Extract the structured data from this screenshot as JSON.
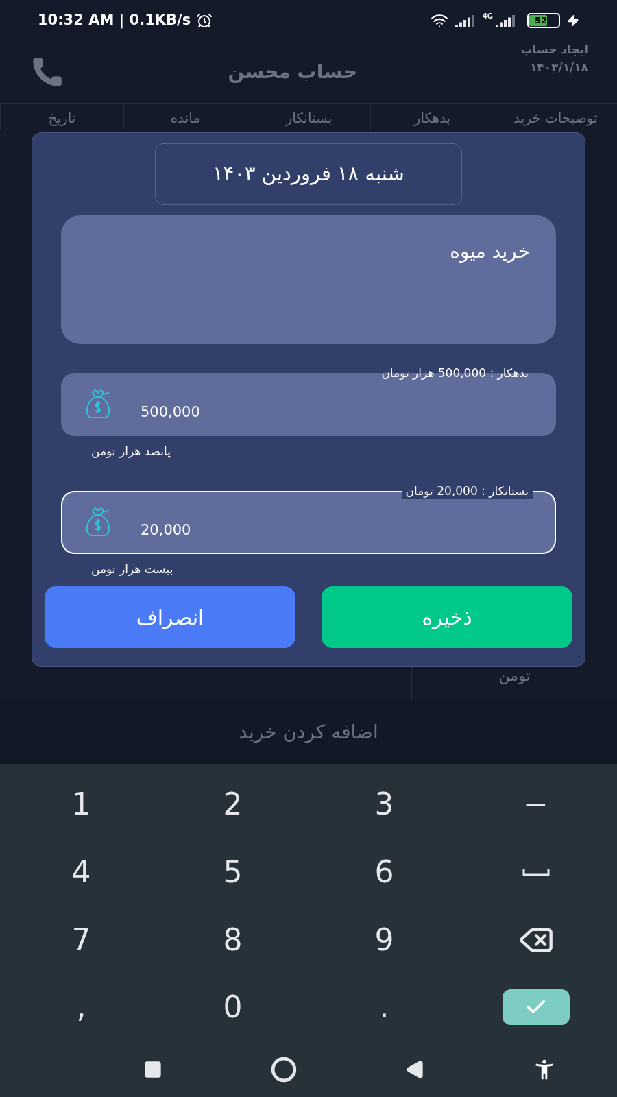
{
  "status_bar": {
    "time": "10:32 AM | 0.1KB/s",
    "network": "4G",
    "battery": "52"
  },
  "header": {
    "title": "حساب محسن",
    "created_label": "ایجاد حساب",
    "created_date": "۱۴۰۳/۱/۱۸"
  },
  "table": {
    "columns": [
      "توضیحات خرید",
      "بدهکار",
      "بستانکار",
      "مانده",
      "تاریخ"
    ],
    "visible_cells": [
      "تومن"
    ]
  },
  "dialog": {
    "date": "شنبه ۱۸ فروردین ۱۴۰۳",
    "description": "خرید میوه",
    "amount_fields": [
      {
        "label": "بدهکار : 500,000 هزار تومان",
        "value": "500,000",
        "helper": "پانصد هزار تومن",
        "focused": false
      },
      {
        "label": "بستانکار : 20,000 تومان",
        "value": "20,000",
        "helper": "بیست هزار تومن",
        "focused": true
      }
    ],
    "buttons": [
      {
        "kind": "save",
        "label": "ذخیره"
      },
      {
        "kind": "cancel",
        "label": "انصراف"
      }
    ]
  },
  "add_button": "اضافه کردن خرید",
  "keyboard": [
    {
      "kind": "text",
      "label": "−"
    },
    {
      "kind": "text",
      "label": "3"
    },
    {
      "kind": "text",
      "label": "2"
    },
    {
      "kind": "text",
      "label": "1"
    },
    {
      "kind": "space"
    },
    {
      "kind": "text",
      "label": "6"
    },
    {
      "kind": "text",
      "label": "5"
    },
    {
      "kind": "text",
      "label": "4"
    },
    {
      "kind": "backspace"
    },
    {
      "kind": "text",
      "label": "9"
    },
    {
      "kind": "text",
      "label": "8"
    },
    {
      "kind": "text",
      "label": "7"
    },
    {
      "kind": "enter"
    },
    {
      "kind": "text",
      "label": "."
    },
    {
      "kind": "text",
      "label": "0"
    },
    {
      "kind": "text",
      "label": ","
    }
  ]
}
